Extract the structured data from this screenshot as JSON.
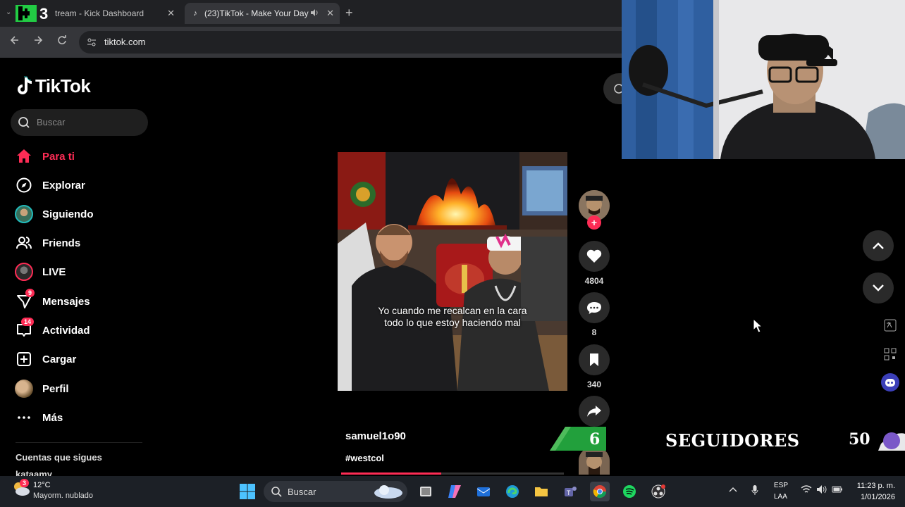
{
  "browser": {
    "tabs": [
      {
        "title": "tream - Kick Dashboard",
        "close": "✕"
      },
      {
        "title": "(23)TikTok - Make Your Day",
        "close": "✕"
      }
    ],
    "new_tab": "+",
    "url": "tiktok.com",
    "overlay_logo": "K3"
  },
  "tiktok": {
    "logo": "TikTok",
    "search_placeholder": "Buscar",
    "nav": [
      {
        "label": "Para ti",
        "icon": "home-icon",
        "active": true
      },
      {
        "label": "Explorar",
        "icon": "compass-icon"
      },
      {
        "label": "Siguiendo",
        "icon": "following-avatar"
      },
      {
        "label": "Friends",
        "icon": "friends-icon"
      },
      {
        "label": "LIVE",
        "icon": "live-avatar"
      },
      {
        "label": "Mensajes",
        "icon": "messages-icon",
        "badge": "9"
      },
      {
        "label": "Actividad",
        "icon": "activity-icon",
        "badge": "14"
      },
      {
        "label": "Cargar",
        "icon": "upload-icon"
      },
      {
        "label": "Perfil",
        "icon": "profile-avatar"
      },
      {
        "label": "Más",
        "icon": "more-icon"
      }
    ],
    "following_heading": "Cuentas que sigues",
    "following_first": "kataamy"
  },
  "video": {
    "caption_line1": "Yo cuando me recalcan en la cara",
    "caption_line2": "todo lo que estoy haciendo mal",
    "author": "samuel1o90",
    "hashtag": "#westcol",
    "progress_fraction": 0.45,
    "likes": "4804",
    "comments": "8",
    "saves": "340"
  },
  "overlay": {
    "followers_current": "6",
    "followers_label": "SEGUIDORES",
    "followers_target": "50"
  },
  "taskbar": {
    "weather_badge": "3",
    "temperature": "12°C",
    "weather": "Mayorm. nublado",
    "search": "Buscar",
    "lang_line1": "ESP",
    "lang_line2": "LAA",
    "time": "11:23 p. m.",
    "date": "1/01/2026"
  },
  "colors": {
    "accent": "#fe2c55",
    "tab_bg": "#202124",
    "toolbar_bg": "#35363a",
    "goal_green": "#22a03c"
  }
}
